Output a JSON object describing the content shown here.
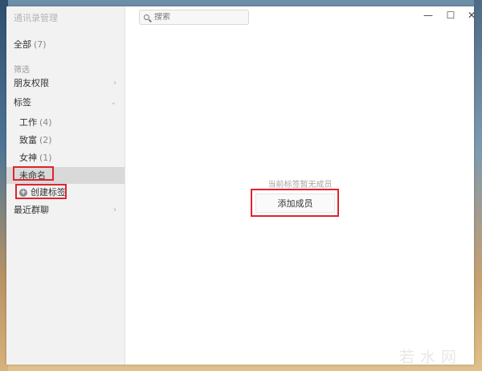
{
  "app": {
    "title": "通讯录管理"
  },
  "sidebar": {
    "all": {
      "label": "全部",
      "count": "(7)"
    },
    "filter_section": "筛选",
    "friend_perm": {
      "label": "朋友权限"
    },
    "tags_header": {
      "label": "标签"
    },
    "tags": [
      {
        "label": "工作",
        "count": "(4)"
      },
      {
        "label": "致富",
        "count": "(2)"
      },
      {
        "label": "女神",
        "count": "(1)"
      }
    ],
    "unnamed": {
      "label": "未命名"
    },
    "create_tag": {
      "label": "创建标签"
    },
    "recent_groups": {
      "label": "最近群聊"
    }
  },
  "search": {
    "placeholder": "搜索"
  },
  "window_controls": {
    "minimize": "—",
    "maximize": "☐",
    "close": "✕"
  },
  "main": {
    "empty_message": "当前标签暂无成员",
    "add_member_label": "添加成员"
  },
  "watermark": "若水网",
  "colors": {
    "highlight": "#e0242d",
    "selected_bg": "#d9d9d9"
  },
  "icons": [
    "search-icon",
    "plus-circle-icon",
    "chevron-right-icon",
    "chevron-down-icon"
  ]
}
